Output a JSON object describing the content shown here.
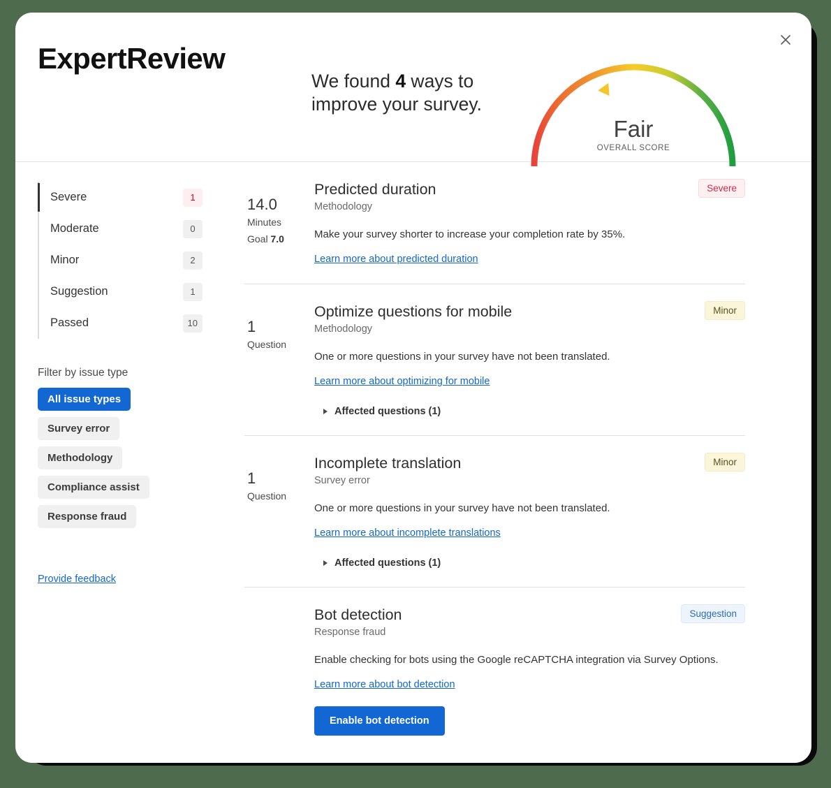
{
  "app": {
    "brand": "ExpertReview",
    "close_label": "×"
  },
  "header": {
    "headline_prefix": "We found ",
    "headline_count": "4",
    "headline_suffix": " ways to improve your survey.",
    "gauge": {
      "score_label": "Fair",
      "score_caption": "OVERALL SCORE",
      "marker_percent": 38,
      "colors": {
        "start": "#e8433a",
        "mid_orange": "#f0922f",
        "mid_yellow": "#f5cc28",
        "end": "#1f9d40",
        "marker": "#f5c62a"
      }
    }
  },
  "sidebar": {
    "severities": [
      {
        "label": "Severe",
        "count": "1",
        "active": true,
        "tone": "severe"
      },
      {
        "label": "Moderate",
        "count": "0",
        "active": false,
        "tone": "neutral"
      },
      {
        "label": "Minor",
        "count": "2",
        "active": false,
        "tone": "neutral"
      },
      {
        "label": "Suggestion",
        "count": "1",
        "active": false,
        "tone": "neutral"
      },
      {
        "label": "Passed",
        "count": "10",
        "active": false,
        "tone": "neutral"
      }
    ],
    "filter_title": "Filter by issue type",
    "filters": [
      {
        "label": "All issue types",
        "selected": true
      },
      {
        "label": "Survey error",
        "selected": false
      },
      {
        "label": "Methodology",
        "selected": false
      },
      {
        "label": "Compliance assist",
        "selected": false
      },
      {
        "label": "Response fraud",
        "selected": false
      }
    ],
    "feedback_link": "Provide feedback"
  },
  "issues": [
    {
      "metric_value": "14.0",
      "metric_unit": "Minutes",
      "metric_goal_label": "Goal",
      "metric_goal_value": "7.0",
      "title": "Predicted duration",
      "category": "Methodology",
      "description": "Make your survey shorter to increase your completion rate by 35%.",
      "link": "Learn more about predicted duration",
      "badge": "Severe",
      "badge_tone": "severe",
      "affected": null,
      "cta": null
    },
    {
      "metric_value": "1",
      "metric_unit": "Question",
      "metric_goal_label": "",
      "metric_goal_value": "",
      "title": "Optimize questions for mobile",
      "category": "Methodology",
      "description": "One or more questions in your survey have not been translated.",
      "link": "Learn more about optimizing for mobile",
      "badge": "Minor",
      "badge_tone": "minor",
      "affected": "Affected questions (1)",
      "cta": null
    },
    {
      "metric_value": "1",
      "metric_unit": "Question",
      "metric_goal_label": "",
      "metric_goal_value": "",
      "title": "Incomplete translation",
      "category": "Survey error",
      "description": "One or more questions in your survey have not been translated.",
      "link": "Learn more about incomplete translations",
      "badge": "Minor",
      "badge_tone": "minor",
      "affected": "Affected questions (1)",
      "cta": null
    },
    {
      "metric_value": "",
      "metric_unit": "",
      "metric_goal_label": "",
      "metric_goal_value": "",
      "title": "Bot detection",
      "category": "Response fraud",
      "description": "Enable checking for bots using the Google reCAPTCHA integration via Survey Options.",
      "link": "Learn more about bot detection",
      "badge": "Suggestion",
      "badge_tone": "suggestion",
      "affected": null,
      "cta": "Enable bot detection"
    }
  ]
}
